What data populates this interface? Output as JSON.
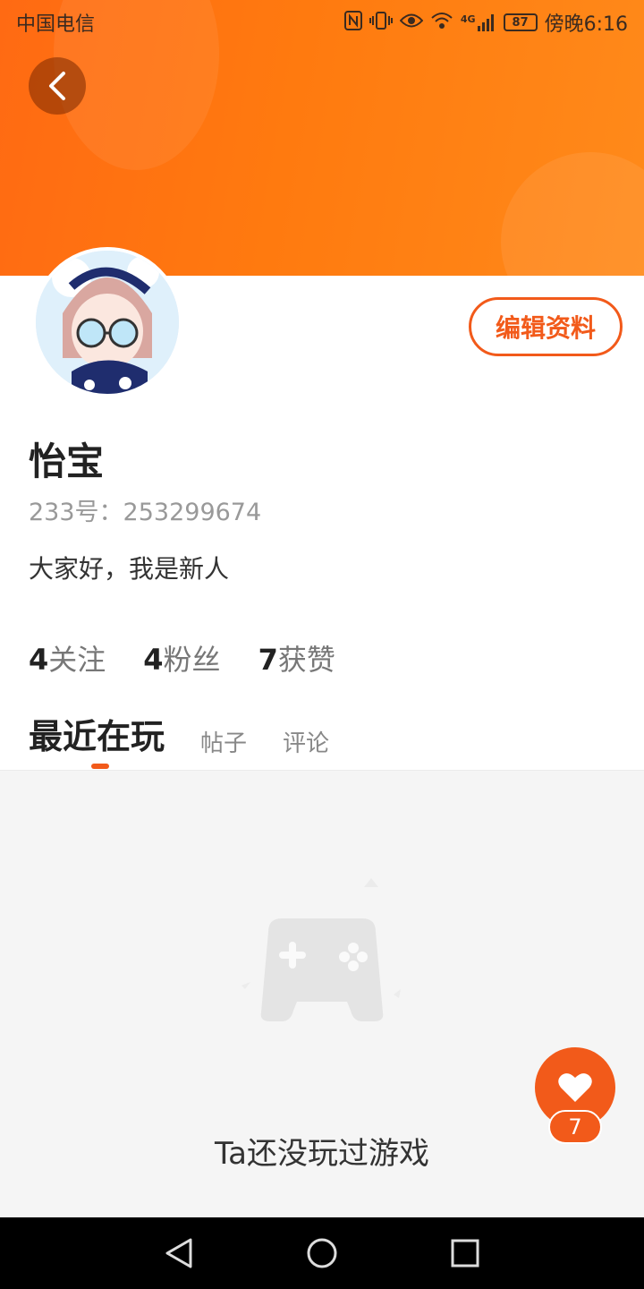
{
  "status_bar": {
    "carrier": "中国电信",
    "network": "4G",
    "battery": "87",
    "time": "傍晚6:16"
  },
  "profile": {
    "nickname": "怡宝",
    "uid_label": "233号：",
    "uid": "253299674",
    "bio": "大家好，我是新人",
    "edit_button": "编辑资料"
  },
  "stats": [
    {
      "count": "4",
      "label": "关注"
    },
    {
      "count": "4",
      "label": "粉丝"
    },
    {
      "count": "7",
      "label": "获赞"
    }
  ],
  "tabs": [
    {
      "label": "最近在玩",
      "active": true
    },
    {
      "label": "帖子",
      "active": false
    },
    {
      "label": "评论",
      "active": false
    }
  ],
  "empty_state": {
    "text": "Ta还没玩过游戏"
  },
  "like": {
    "count": "7"
  },
  "colors": {
    "accent": "#f25a1a",
    "banner": "#ff7a0f"
  }
}
